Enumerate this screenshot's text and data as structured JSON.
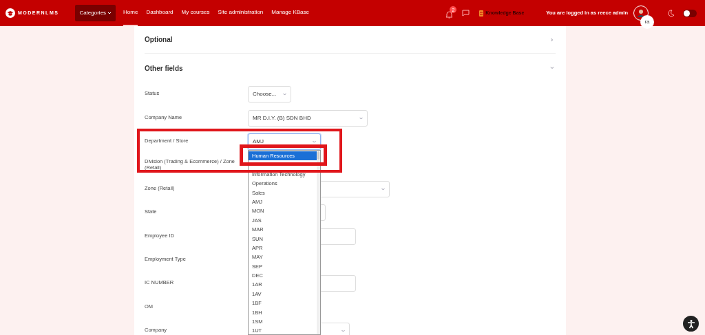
{
  "header": {
    "logo_text": "MODERNLMS",
    "categories": "Categories",
    "nav": [
      {
        "label": "Home",
        "selected": true
      },
      {
        "label": "Dashboard",
        "selected": false
      },
      {
        "label": "My courses",
        "selected": false
      },
      {
        "label": "Site administration",
        "selected": false
      },
      {
        "label": "Manage KBase",
        "selected": false
      }
    ],
    "notification_count": "2",
    "knowledge_base": "Knowledge Base",
    "login_text": "You are logged in as reece admin",
    "avatar_initials": "ra",
    "theme_toggle_on": false
  },
  "sections": [
    {
      "title": "Optional",
      "expanded": false
    },
    {
      "title": "Other fields",
      "expanded": true
    }
  ],
  "fields": [
    {
      "label": "Status",
      "kind": "select",
      "value": "Choose..."
    },
    {
      "label": "Company Name",
      "kind": "select",
      "value": "MR D.I.Y. (B) SDN BHD"
    },
    {
      "label": "Department / Store",
      "kind": "select",
      "value": "AMJ",
      "focused": true
    },
    {
      "label": "Division (Trading & Ecommerce) / Zone (Retail)",
      "kind": "hidden"
    },
    {
      "label": "Zone (Retail)",
      "kind": "select"
    },
    {
      "label": "State",
      "kind": "select"
    },
    {
      "label": "Employee ID",
      "kind": "input"
    },
    {
      "label": "Employment Type",
      "kind": "hidden"
    },
    {
      "label": "IC NUMBER",
      "kind": "input"
    },
    {
      "label": "OM",
      "kind": "hidden"
    },
    {
      "label": "Company",
      "kind": "select"
    }
  ],
  "dropdown_options": [
    {
      "label": "Human Resources",
      "selected": true
    },
    {
      "label": "Information Technology",
      "selected": false
    },
    {
      "label": "Operations",
      "selected": false
    },
    {
      "label": "Sales",
      "selected": false
    },
    {
      "label": "AMJ",
      "selected": false
    },
    {
      "label": "MON",
      "selected": false
    },
    {
      "label": "JAS",
      "selected": false
    },
    {
      "label": "MAR",
      "selected": false
    },
    {
      "label": "SUN",
      "selected": false
    },
    {
      "label": "APR",
      "selected": false
    },
    {
      "label": "MAY",
      "selected": false
    },
    {
      "label": "SEP",
      "selected": false
    },
    {
      "label": "DEC",
      "selected": false
    },
    {
      "label": "1AR",
      "selected": false
    },
    {
      "label": "1AV",
      "selected": false
    },
    {
      "label": "1BF",
      "selected": false
    },
    {
      "label": "1BH",
      "selected": false
    },
    {
      "label": "1SM",
      "selected": false
    },
    {
      "label": "1UT",
      "selected": false
    }
  ]
}
